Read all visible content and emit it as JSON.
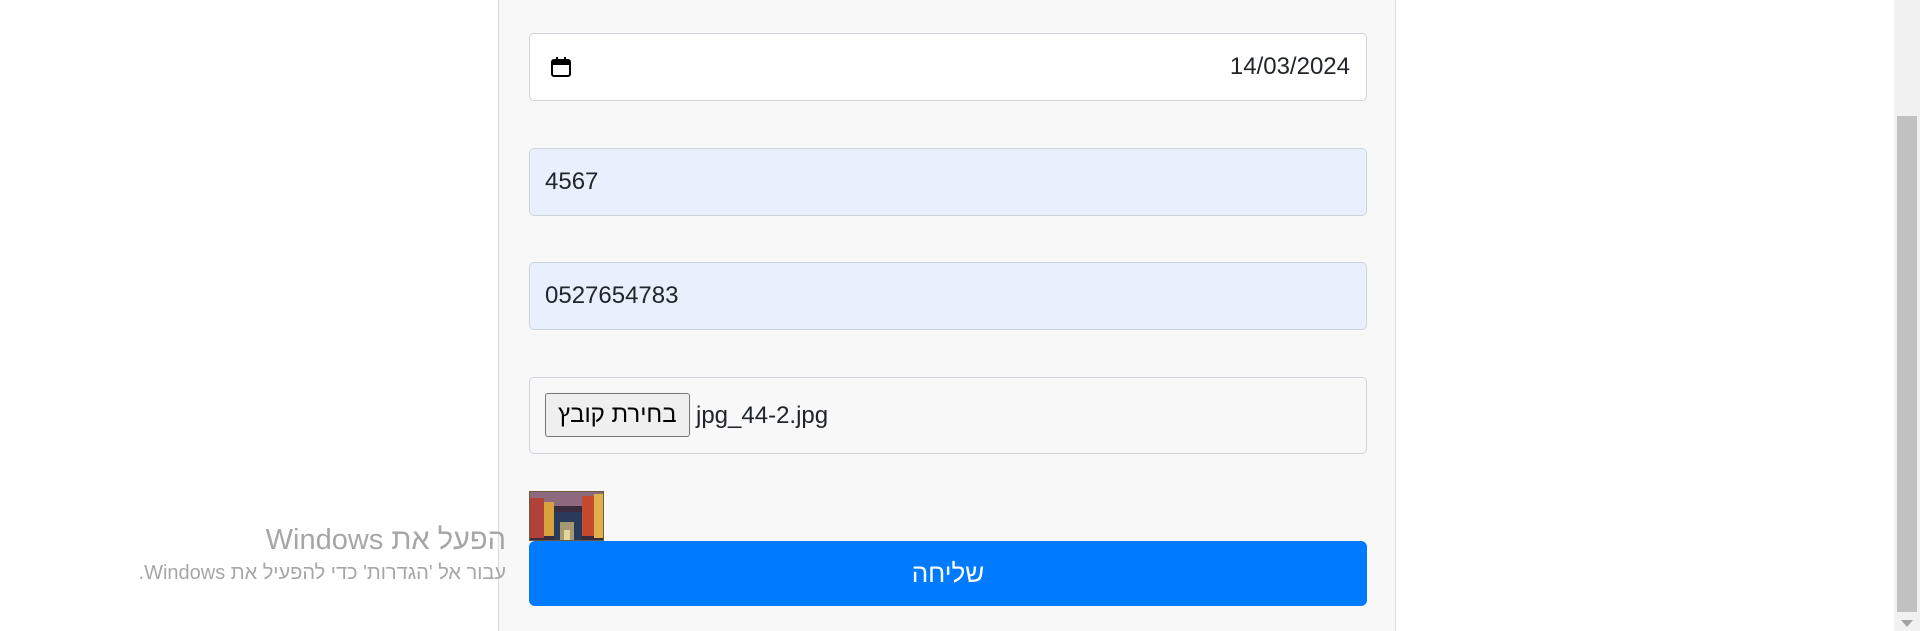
{
  "form": {
    "date_value": "14/03/2024",
    "code_value": "4567",
    "phone_value": "0527654783",
    "file_button_label": "בחירת קובץ",
    "file_name": "jpg_44-2.jpg",
    "submit_label": "שליחה"
  },
  "watermark": {
    "title": "הפעל את Windows",
    "subtitle": "עבור אל 'הגדרות' כדי להפעיל את Windows."
  },
  "icons": {
    "calendar": "calendar-icon",
    "scroll_down": "chevron-down-icon"
  },
  "colors": {
    "accent": "#007bff",
    "autofill_bg": "#e8f0fe",
    "panel_bg": "#f8f8f8"
  }
}
